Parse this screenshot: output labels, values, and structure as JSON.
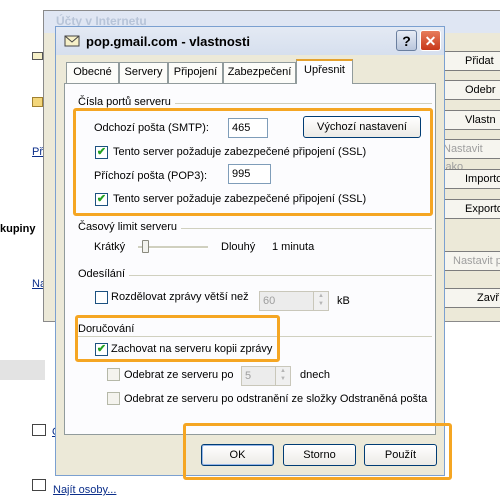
{
  "background": {
    "window_title": "Účty v Internetu",
    "left_items": [
      {
        "text": "Př",
        "type": "link"
      },
      {
        "text": "kupiny",
        "type": "bold"
      },
      {
        "text": "Na",
        "type": "link"
      },
      {
        "text": "O",
        "type": "link"
      },
      {
        "text": "Najít osoby...",
        "type": "link"
      }
    ],
    "right_buttons": [
      "Přidat",
      "Odebr",
      "Vlastn",
      "Nastavit jako",
      "Importo",
      "Exporto",
      "Nastavit p",
      "Zavř"
    ]
  },
  "dialog": {
    "title": "pop.gmail.com - vlastnosti",
    "help_label": "?",
    "close_label": "✕",
    "tabs": [
      "Obecné",
      "Servery",
      "Připojení",
      "Zabezpečení",
      "Upřesnit"
    ],
    "active_tab": "Upřesnit",
    "ports": {
      "group_title": "Čísla portů serveru",
      "smtp_label": "Odchozí pošta (SMTP):",
      "smtp_value": "465",
      "default_button": "Výchozí nastavení",
      "smtp_ssl_label": "Tento server požaduje zabezpečené připojení (SSL)",
      "smtp_ssl_checked": true,
      "pop3_label": "Příchozí pošta (POP3):",
      "pop3_value": "995",
      "pop3_ssl_label": "Tento server požaduje zabezpečené připojení (SSL)",
      "pop3_ssl_checked": true
    },
    "timeout": {
      "group_title": "Časový limit serveru",
      "short_label": "Krátký",
      "long_label": "Dlouhý",
      "value_text": "1 minuta",
      "level": 0.05
    },
    "sending": {
      "group_title": "Odesílání",
      "split_label": "Rozdělovat zprávy větší než",
      "split_checked": false,
      "split_value": "60",
      "split_unit": "kB"
    },
    "delivery": {
      "group_title": "Doručování",
      "keep_copy_label": "Zachovat na serveru kopii zprávy",
      "keep_copy_checked": true,
      "remove_after_label": "Odebrat ze serveru po",
      "remove_after_checked": false,
      "remove_after_value": "5",
      "remove_after_unit": "dnech",
      "remove_deleted_label": "Odebrat ze serveru po odstranění ze složky Odstraněná pošta",
      "remove_deleted_checked": false
    },
    "buttons": {
      "ok": "OK",
      "cancel": "Storno",
      "apply": "Použít"
    }
  },
  "colors": {
    "highlight": "#f5a623",
    "dialog_bg": "#ece9d8",
    "checkmark": "#21a121"
  }
}
